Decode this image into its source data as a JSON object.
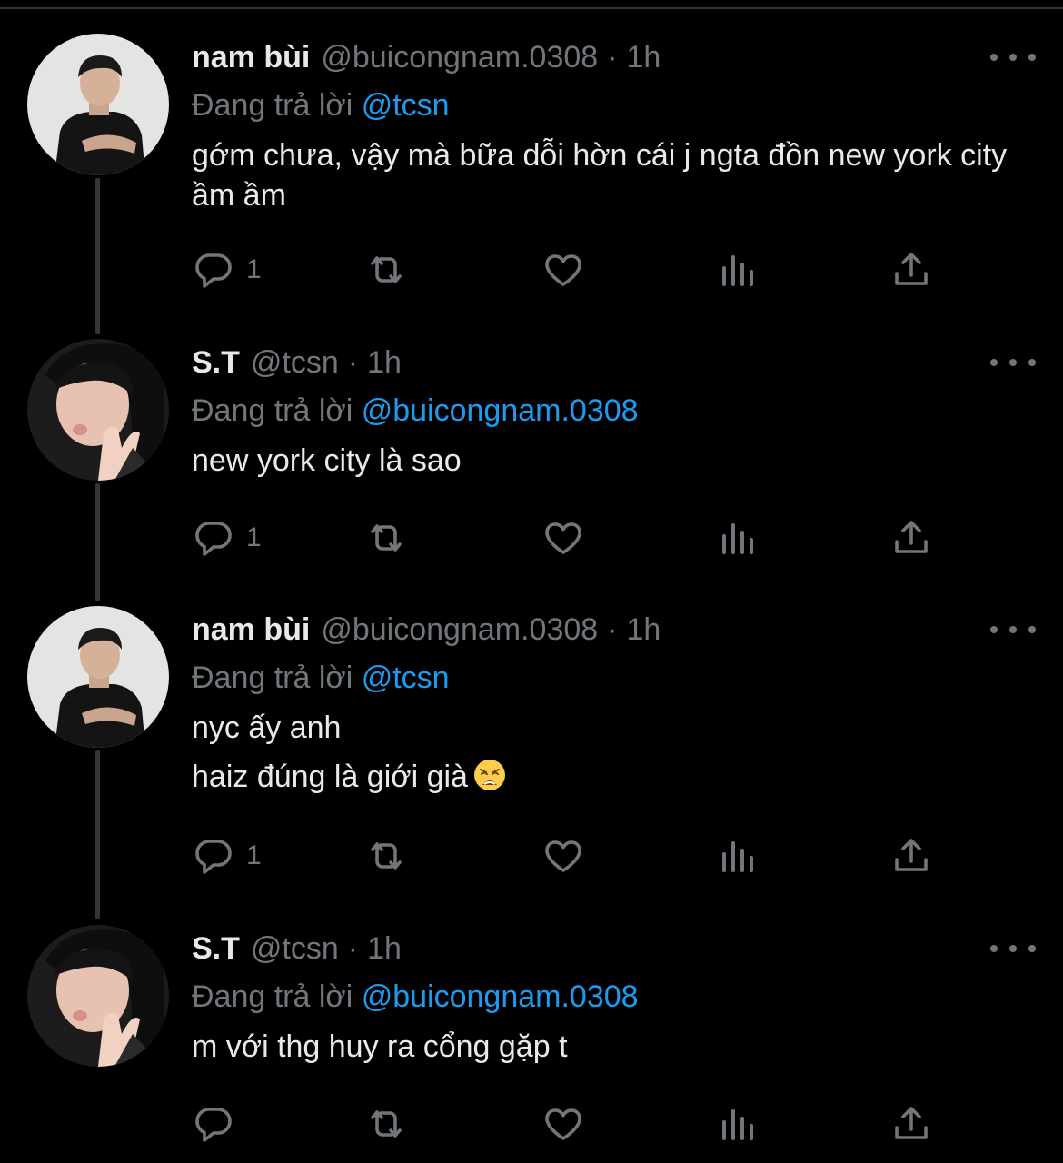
{
  "tweets": [
    {
      "name": "nam bùi",
      "handle": "@buicongnam.0308",
      "dot": "·",
      "time": "1h",
      "reply_prefix": "Đang trả lời",
      "reply_to": "@tcsn",
      "lines": [
        "gớm chưa, vậy mà bữa dỗi hờn cái j ngta đồn new york city ầm ầm"
      ],
      "reply_count": "1"
    },
    {
      "name": "S.T",
      "handle": "@tcsn",
      "dot": "·",
      "time": "1h",
      "reply_prefix": "Đang trả lời",
      "reply_to": "@buicongnam.0308",
      "lines": [
        "new york city là sao"
      ],
      "reply_count": "1"
    },
    {
      "name": "nam bùi",
      "handle": "@buicongnam.0308",
      "dot": "·",
      "time": "1h",
      "reply_prefix": "Đang trả lời",
      "reply_to": "@tcsn",
      "lines": [
        "nyc ấy anh",
        "haiz đúng là giới già"
      ],
      "emoji": "weary-face-emoji",
      "reply_count": "1"
    },
    {
      "name": "S.T",
      "handle": "@tcsn",
      "dot": "·",
      "time": "1h",
      "reply_prefix": "Đang trả lời",
      "reply_to": "@buicongnam.0308",
      "lines": [
        "m với thg huy ra cổng gặp t"
      ],
      "reply_count": ""
    }
  ],
  "icons": {
    "reply": "reply-icon",
    "retweet": "retweet-icon",
    "like": "heart-icon",
    "views": "views-icon",
    "share": "share-icon",
    "more": "more-icon"
  },
  "colors": {
    "background": "#000000",
    "text": "#e7e9ea",
    "secondary": "#71767b",
    "link": "#1d9bf0",
    "thread_line": "#333639"
  }
}
